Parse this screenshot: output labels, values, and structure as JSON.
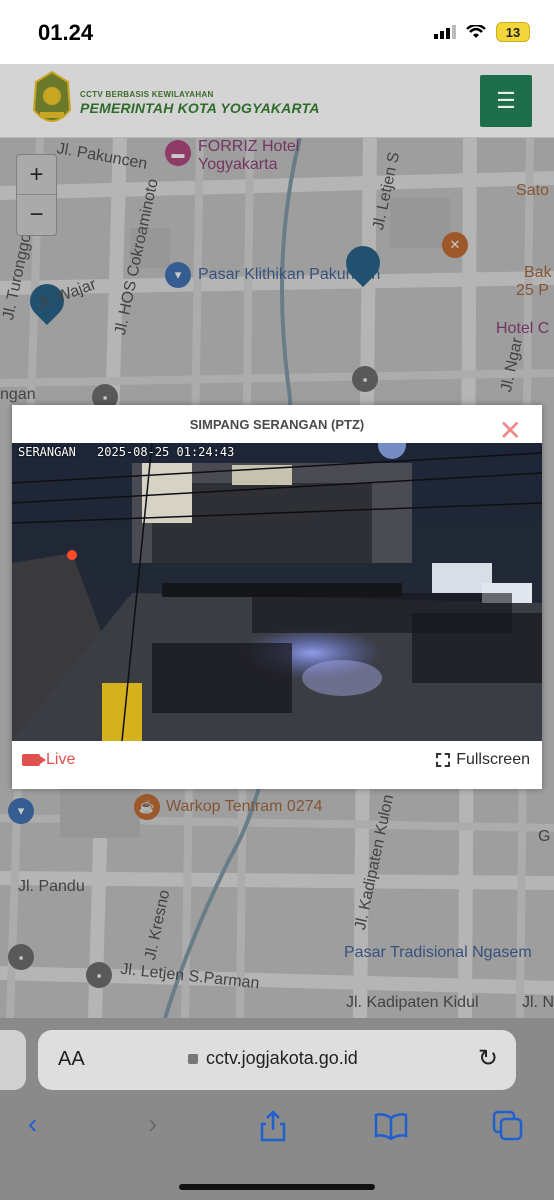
{
  "status": {
    "time": "01.24",
    "battery": "13"
  },
  "header": {
    "logo_sub": "CCTV BERBASIS KEWILAYAHAN",
    "logo_main": "PEMERINTAH KOTA YOGYAKARTA",
    "menu_icon": "hamburger-icon"
  },
  "map": {
    "zoom_in": "+",
    "zoom_out": "−",
    "labels": {
      "pakuncen": "Jl. Pakuncen",
      "forriz_1": "FORRIZ Hotel",
      "forriz_2": "Yogyakarta",
      "letjen_s": "Jl. Letjen S",
      "sato": "Sato",
      "turonggo": "Jl. Turonggo",
      "hos": "Jl. HOS Cokroaminoto",
      "pasar_klithikan": "Pasar Klithikan Pakuncen",
      "bak": "Bak",
      "bak2": "25 P",
      "hotel_c": "Hotel C",
      "ngar": "Jl. Ngar",
      "ngan": "ngan",
      "wajar": "Jl. Wajar",
      "warkop": "Warkop Tentram 0274",
      "pandu": "Jl. Pandu",
      "kresno": "Jl. Kresno",
      "kadipaten_kulon": "Jl. Kadipaten Kulon",
      "pasar_trad": "Pasar Tradisional Ngasem",
      "letjen_parman": "Jl. Letjen S.Parman",
      "kadipaten_kidul": "Jl. Kadipaten Kidul",
      "g": "G",
      "jln": "Jl. N",
      "s": "S"
    }
  },
  "modal": {
    "title": "SIMPANG SERANGAN (PTZ)",
    "close": "✕",
    "cam_name": "SERANGAN",
    "cam_timestamp": "2025-08-25 01:24:43",
    "live_label": "Live",
    "fullscreen_label": "Fullscreen"
  },
  "browser": {
    "aa": "AA",
    "url": "cctv.jogjakota.go.id",
    "reload": "↻"
  },
  "toolbar": {
    "back": "‹",
    "forward": "›",
    "share": "⇧",
    "bookmarks": "📖",
    "tabs": "⧉"
  }
}
